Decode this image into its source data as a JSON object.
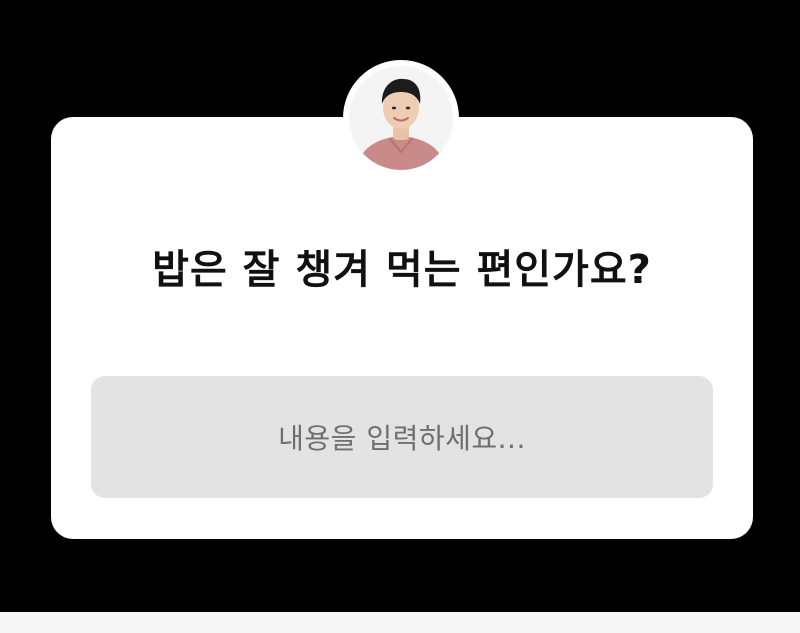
{
  "story": {
    "question": "밥은 잘 챙겨 먹는 편인가요?",
    "answer_placeholder": "내용을 입력하세요..."
  },
  "colors": {
    "backdrop": "#000000",
    "card": "#ffffff",
    "input_background": "#e3e3e3",
    "placeholder_text": "#6f6f6f",
    "question_text": "#111111"
  }
}
